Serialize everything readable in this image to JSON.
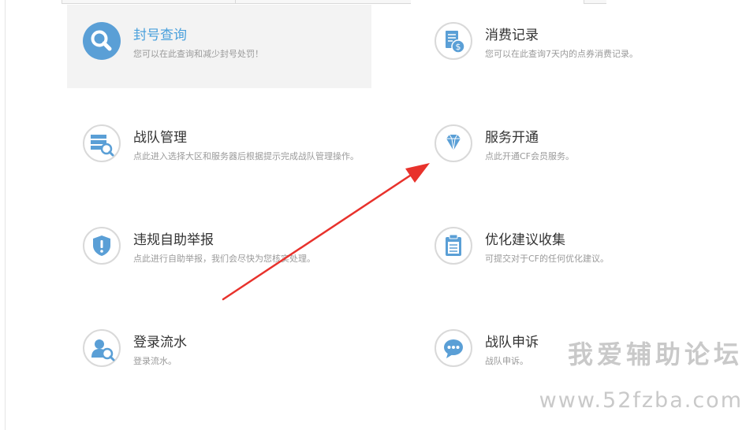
{
  "colors": {
    "accent_blue": "#4aa0dc",
    "icon_blue": "#5a9fd6",
    "arrow_red": "#e8322c",
    "desc_gray": "#9a9a9a",
    "active_bg": "#f3f3f3"
  },
  "cards": [
    {
      "id": "ban-query",
      "title": "封号查询",
      "desc": "您可以在此查询和减少封号处罚！",
      "icon": "search-icon",
      "active": true
    },
    {
      "id": "consumption-record",
      "title": "消费记录",
      "desc": "您可以在此查询7天内的点券消费记录。",
      "icon": "bill-dollar-icon",
      "active": false
    },
    {
      "id": "team-management",
      "title": "战队管理",
      "desc": "点此进入选择大区和服务器后根据提示完成战队管理操作。",
      "icon": "server-search-icon",
      "active": false
    },
    {
      "id": "service-activation",
      "title": "服务开通",
      "desc": "点此开通CF会员服务。",
      "icon": "diamond-icon",
      "active": false
    },
    {
      "id": "violation-report",
      "title": "违规自助举报",
      "desc": "点此进行自助举报，我们会尽快为您核实处理。",
      "icon": "shield-alert-icon",
      "active": false
    },
    {
      "id": "suggestion-collection",
      "title": "优化建议收集",
      "desc": "可提交对于CF的任何优化建议。",
      "icon": "clipboard-icon",
      "active": false
    },
    {
      "id": "login-history",
      "title": "登录流水",
      "desc": "登录流水。",
      "icon": "user-search-icon",
      "active": false
    },
    {
      "id": "team-appeal",
      "title": "战队申诉",
      "desc": "战队申诉。",
      "icon": "chat-bubble-icon",
      "active": false
    }
  ],
  "watermark": {
    "text_cn": "我爱辅助论坛",
    "text_url": "www.52fzba.com"
  }
}
